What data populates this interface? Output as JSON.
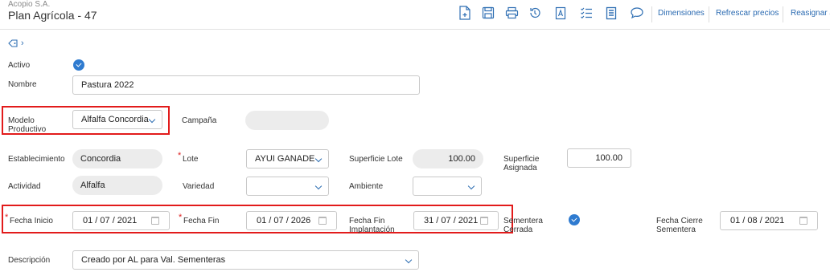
{
  "header": {
    "company": "Acopio S.A.",
    "title": "Plan Agrícola - 47"
  },
  "toolbar": {
    "icons": [
      "new-document-icon",
      "save-icon",
      "print-icon",
      "history-icon",
      "text-format-icon",
      "checklist-icon",
      "notes-icon",
      "comment-icon"
    ],
    "links": [
      "Dimensiones",
      "Refrescar precios",
      "Reasignar a"
    ]
  },
  "form": {
    "activo_label": "Activo",
    "nombre_label": "Nombre",
    "nombre_value": "Pastura 2022",
    "modelo_label": "Modelo Productivo",
    "modelo_value": "Alfalfa Concordia",
    "campana_label": "Campaña",
    "campana_value": "",
    "establecimiento_label": "Establecimiento",
    "establecimiento_value": "Concordia",
    "lote_label": "Lote",
    "lote_value": "AYUI GANADE",
    "superficie_lote_label": "Superficie Lote",
    "superficie_lote_value": "100.00",
    "superficie_asignada_label": "Superficie Asignada",
    "superficie_asignada_value": "100.00",
    "actividad_label": "Actividad",
    "actividad_value": "Alfalfa",
    "variedad_label": "Variedad",
    "variedad_value": "",
    "ambiente_label": "Ambiente",
    "ambiente_value": "",
    "fecha_inicio_label": "Fecha Inicio",
    "fecha_inicio_value": "01 / 07 / 2021",
    "fecha_fin_label": "Fecha Fin",
    "fecha_fin_value": "01 / 07 / 2026",
    "fecha_fin_impl_label": "Fecha Fin Implantación",
    "fecha_fin_impl_value": "31 / 07 / 2021",
    "sementera_label": "Sementera Cerrada",
    "fecha_cierre_label": "Fecha Cierre Sementera",
    "fecha_cierre_value": "01 / 08 / 2021",
    "descripcion_label": "Descripción",
    "descripcion_value": "Creado por AL para Val. Sementeras"
  },
  "colors": {
    "accent": "#2f6fb3",
    "highlight": "#e21b1b",
    "readonly_bg": "#ececec"
  }
}
